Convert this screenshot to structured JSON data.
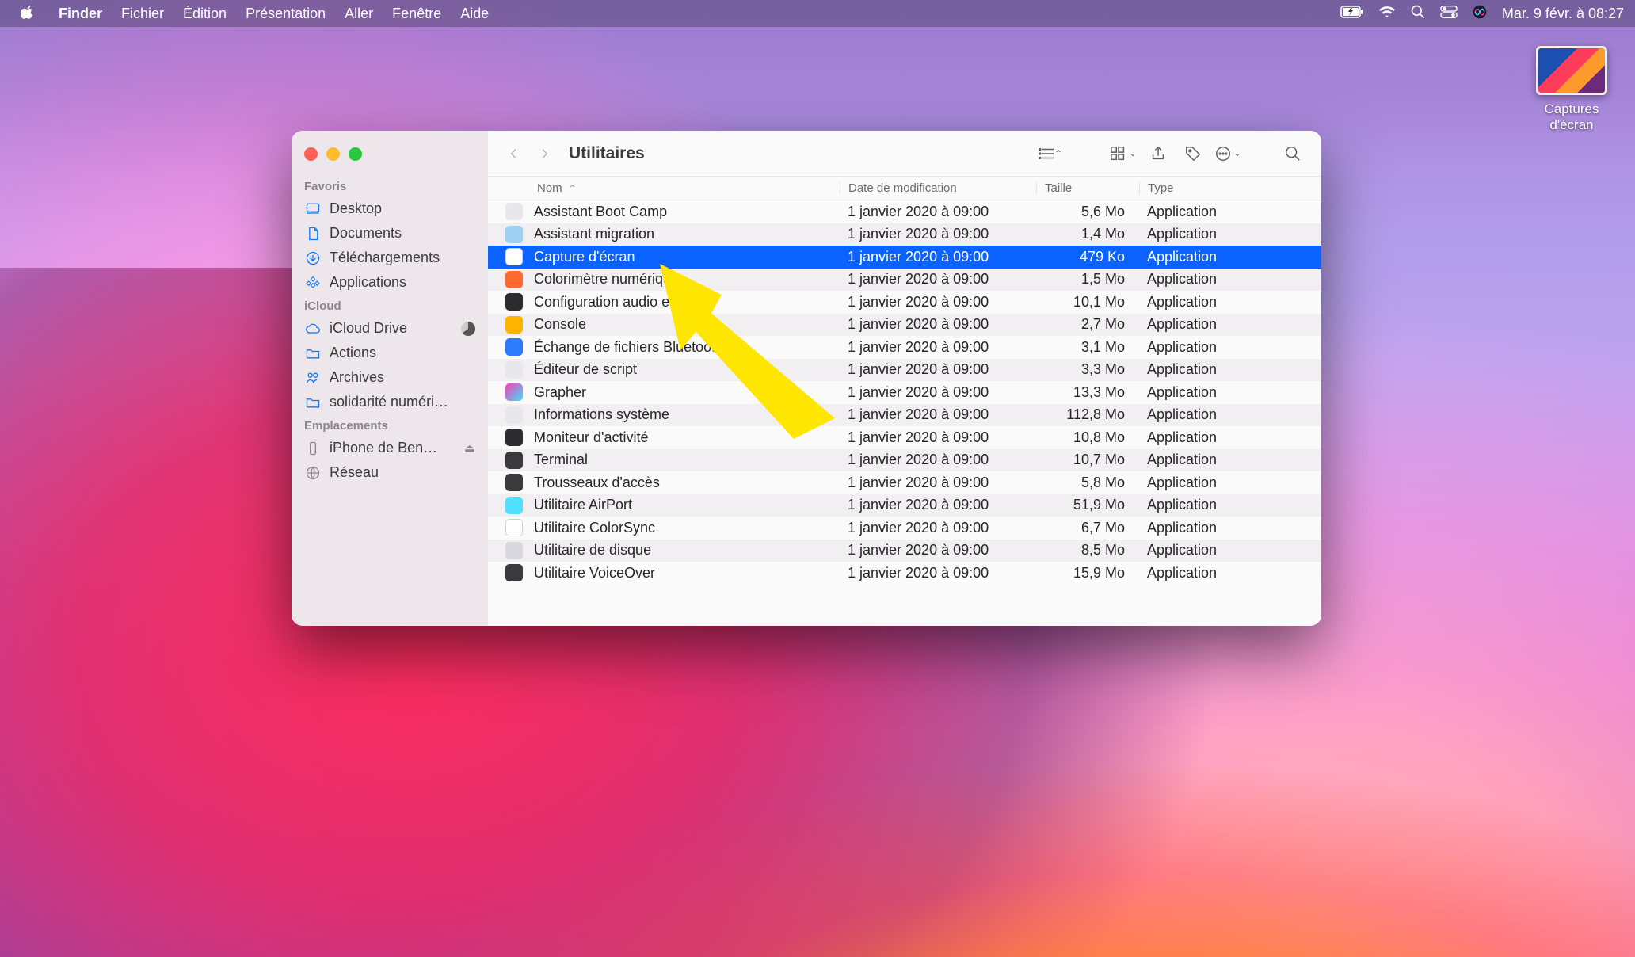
{
  "menubar": {
    "app": "Finder",
    "items": [
      "Fichier",
      "Édition",
      "Présentation",
      "Aller",
      "Fenêtre",
      "Aide"
    ],
    "clock": "Mar. 9 févr. à  08:27"
  },
  "desktop_icon": {
    "label": "Captures d'écran"
  },
  "finder": {
    "title": "Utilitaires",
    "columns": {
      "name": "Nom",
      "date": "Date de modification",
      "size": "Taille",
      "kind": "Type"
    },
    "sidebar": {
      "favoris_head": "Favoris",
      "favoris": [
        {
          "label": "Desktop",
          "icon": "desktop"
        },
        {
          "label": "Documents",
          "icon": "doc"
        },
        {
          "label": "Téléchargements",
          "icon": "download"
        },
        {
          "label": "Applications",
          "icon": "apps"
        }
      ],
      "icloud_head": "iCloud",
      "icloud": [
        {
          "label": "iCloud Drive",
          "icon": "cloud",
          "badge": true
        },
        {
          "label": "Actions",
          "icon": "folder"
        },
        {
          "label": "Archives",
          "icon": "people"
        },
        {
          "label": "solidarité numéri…",
          "icon": "folder"
        }
      ],
      "emplacements_head": "Emplacements",
      "emplacements": [
        {
          "label": "iPhone de Ben…",
          "icon": "phone",
          "eject": true
        },
        {
          "label": "Réseau",
          "icon": "globe"
        }
      ]
    },
    "rows": [
      {
        "name": "Assistant Boot Camp",
        "date": "1 janvier 2020 à 09:00",
        "size": "5,6 Mo",
        "kind": "Application",
        "ic": "c1"
      },
      {
        "name": "Assistant migration",
        "date": "1 janvier 2020 à 09:00",
        "size": "1,4 Mo",
        "kind": "Application",
        "ic": "c2"
      },
      {
        "name": "Capture d'écran",
        "date": "1 janvier 2020 à 09:00",
        "size": "479 Ko",
        "kind": "Application",
        "ic": "c3",
        "selected": true
      },
      {
        "name": "Colorimètre numérique",
        "date": "1 janvier 2020 à 09:00",
        "size": "1,5 Mo",
        "kind": "Application",
        "ic": "c4"
      },
      {
        "name": "Configuration audio et MIDI",
        "date": "1 janvier 2020 à 09:00",
        "size": "10,1 Mo",
        "kind": "Application",
        "ic": "c5"
      },
      {
        "name": "Console",
        "date": "1 janvier 2020 à 09:00",
        "size": "2,7 Mo",
        "kind": "Application",
        "ic": "c6"
      },
      {
        "name": "Échange de fichiers Bluetooth",
        "date": "1 janvier 2020 à 09:00",
        "size": "3,1 Mo",
        "kind": "Application",
        "ic": "c7"
      },
      {
        "name": "Éditeur de script",
        "date": "1 janvier 2020 à 09:00",
        "size": "3,3 Mo",
        "kind": "Application",
        "ic": "c1"
      },
      {
        "name": "Grapher",
        "date": "1 janvier 2020 à 09:00",
        "size": "13,3 Mo",
        "kind": "Application",
        "ic": "c8"
      },
      {
        "name": "Informations système",
        "date": "1 janvier 2020 à 09:00",
        "size": "112,8 Mo",
        "kind": "Application",
        "ic": "c1"
      },
      {
        "name": "Moniteur d'activité",
        "date": "1 janvier 2020 à 09:00",
        "size": "10,8 Mo",
        "kind": "Application",
        "ic": "c9"
      },
      {
        "name": "Terminal",
        "date": "1 janvier 2020 à 09:00",
        "size": "10,7 Mo",
        "kind": "Application",
        "ic": "c10"
      },
      {
        "name": "Trousseaux d'accès",
        "date": "1 janvier 2020 à 09:00",
        "size": "5,8 Mo",
        "kind": "Application",
        "ic": "c14"
      },
      {
        "name": "Utilitaire AirPort",
        "date": "1 janvier 2020 à 09:00",
        "size": "51,9 Mo",
        "kind": "Application",
        "ic": "c11"
      },
      {
        "name": "Utilitaire ColorSync",
        "date": "1 janvier 2020 à 09:00",
        "size": "6,7 Mo",
        "kind": "Application",
        "ic": "c12"
      },
      {
        "name": "Utilitaire de disque",
        "date": "1 janvier 2020 à 09:00",
        "size": "8,5 Mo",
        "kind": "Application",
        "ic": "c13"
      },
      {
        "name": "Utilitaire VoiceOver",
        "date": "1 janvier 2020 à 09:00",
        "size": "15,9 Mo",
        "kind": "Application",
        "ic": "c14"
      }
    ]
  }
}
